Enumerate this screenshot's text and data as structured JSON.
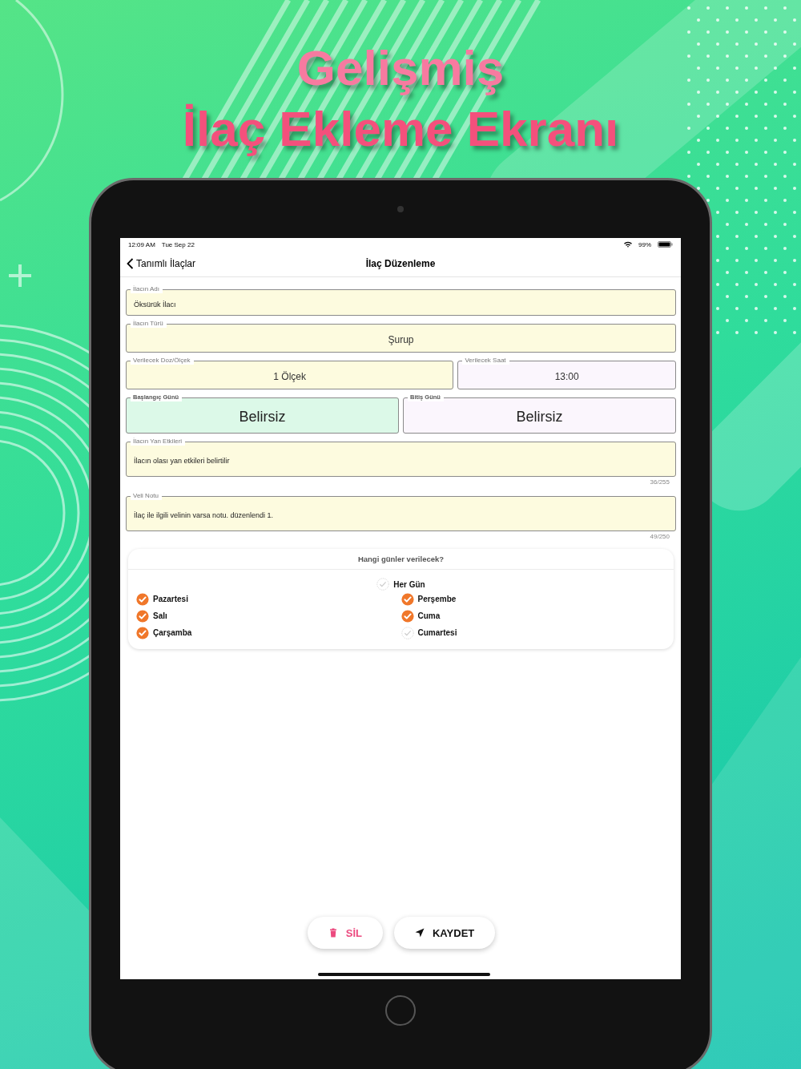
{
  "headline": [
    "Gelişmiş",
    "İlaç Ekleme Ekranı"
  ],
  "status_bar": {
    "time": "12:09 AM",
    "date": "Tue Sep 22",
    "battery": "99%"
  },
  "nav": {
    "back": "Tanımlı İlaçlar",
    "title": "İlaç Düzenleme"
  },
  "form": {
    "rows": [
      {
        "fields": [
          {
            "kind": "text",
            "label": "İlacın Adı",
            "value": "Öksürük İlacı",
            "color": "#fdfbdf"
          }
        ]
      },
      {
        "fields": [
          {
            "kind": "picker",
            "label": "İlacın Türü",
            "value": "Şurup",
            "color": "#fdfbdf"
          }
        ]
      },
      {
        "fields": [
          {
            "kind": "picker",
            "label": "Verilecek Doz/Ölçek",
            "value": "1 Ölçek",
            "color": "#fdfbdf"
          },
          {
            "kind": "picker",
            "label": "Verilecek Saat",
            "value": "13:00",
            "color": "#fbf6fd"
          }
        ]
      },
      {
        "fields": [
          {
            "kind": "date",
            "label": "Başlangıç Günü",
            "value": "Belirsiz",
            "color": "#dcf9e8"
          },
          {
            "kind": "date",
            "label": "Bitiş Günü",
            "value": "Belirsiz",
            "color": "#fbf6fd"
          }
        ]
      },
      {
        "fields": [
          {
            "kind": "area",
            "label": "İlacın Yan Etkileri",
            "value": "İlacın olası yan etkileri belirtilir",
            "color": "#fdfbdf",
            "counter": "36/255"
          }
        ]
      },
      {
        "fields": [
          {
            "kind": "area",
            "label": "Veli Notu",
            "value": "İlaç ile ilgili velinin varsa notu. düzenlendi 1.",
            "color": "#fdfbdf",
            "counter": "49/250"
          }
        ]
      }
    ]
  },
  "days_card": {
    "title": "Hangi günler verilecek?",
    "all_days": {
      "label": "Her Gün",
      "checked": false
    },
    "days": [
      {
        "label": "Pazartesi",
        "checked": true
      },
      {
        "label": "Salı",
        "checked": true
      },
      {
        "label": "Çarşamba",
        "checked": true
      },
      {
        "label": "Perşembe",
        "checked": true
      },
      {
        "label": "Cuma",
        "checked": true
      },
      {
        "label": "Cumartesi",
        "checked": false
      }
    ]
  },
  "buttons": [
    {
      "kind": "delete",
      "label": "SİL"
    },
    {
      "kind": "save",
      "label": "KAYDET"
    }
  ]
}
